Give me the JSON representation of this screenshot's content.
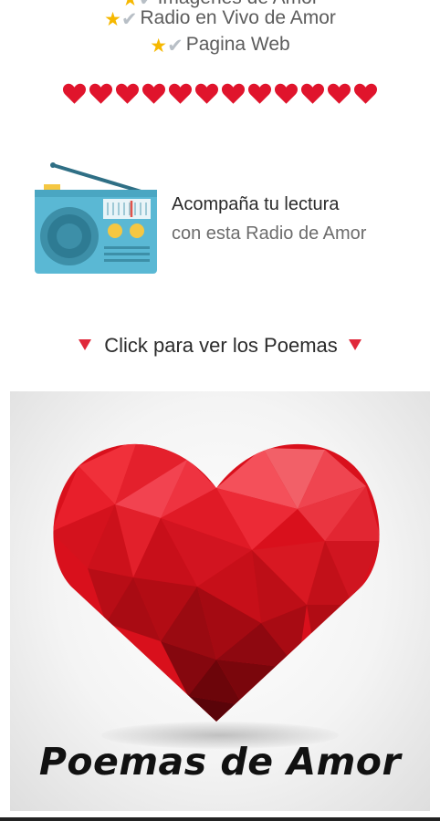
{
  "features": [
    {
      "text": "Imágenes de Amor"
    },
    {
      "text": "Radio en Vivo de Amor"
    },
    {
      "text": "Pagina Web"
    }
  ],
  "icons": {
    "star": "star-icon",
    "check": "check-icon",
    "heart": "heart-icon",
    "radio": "radio-icon",
    "triangle": "triangle-down-icon"
  },
  "hearts_count": 12,
  "radio": {
    "line1": "Acompaña tu lectura",
    "line2": "con esta Radio de Amor"
  },
  "click_prompt": "Click para ver los Poemas",
  "poem_banner": {
    "title": "Poemas de Amor"
  },
  "colors": {
    "heart": "#e0142c",
    "radio_body": "#5ab8d4",
    "radio_accent": "#f5c742"
  }
}
